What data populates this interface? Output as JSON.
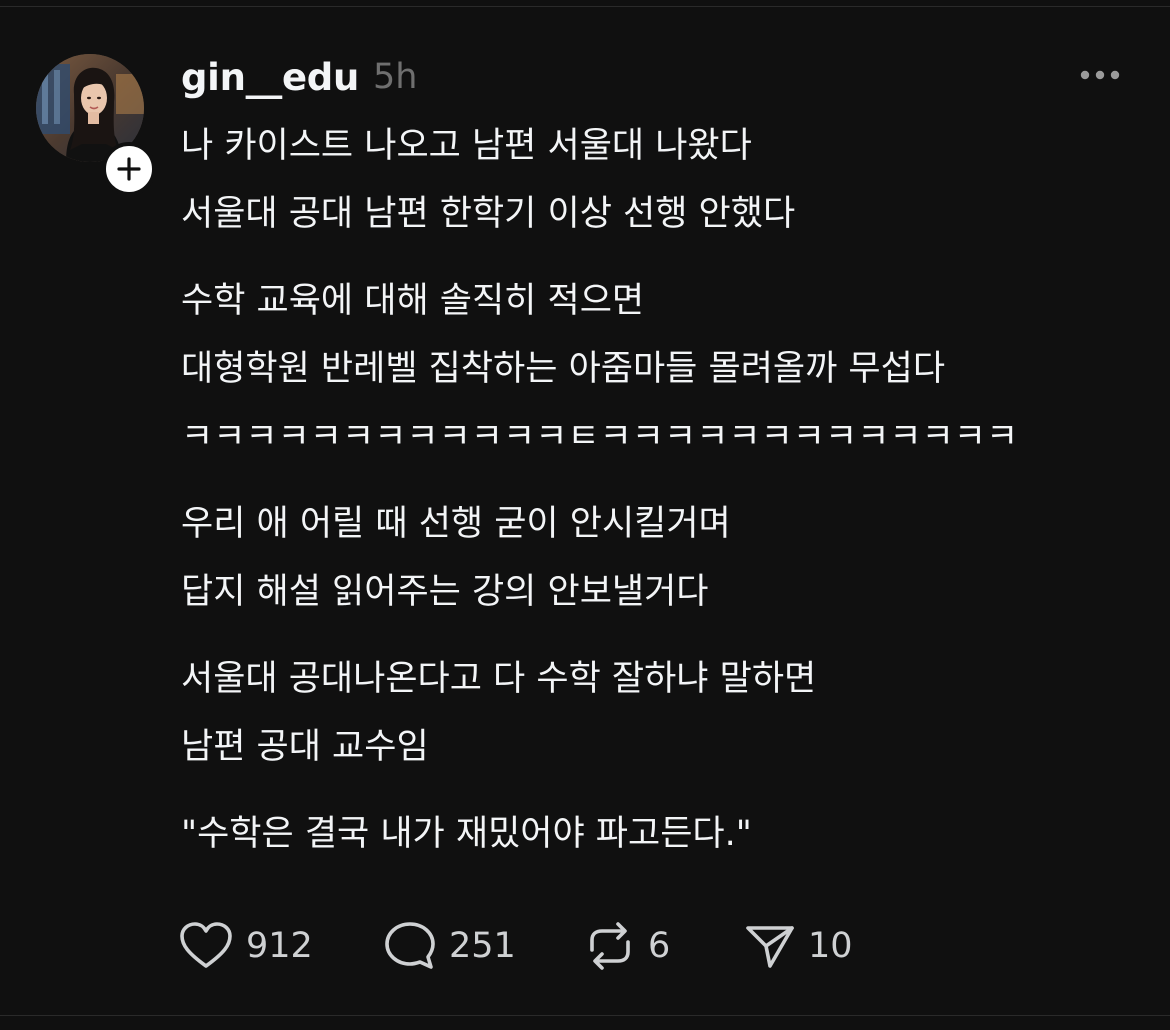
{
  "post": {
    "username": "gin__edu",
    "timestamp": "5h",
    "avatar_icon": "profile-photo",
    "follow_icon": "plus-icon",
    "more_icon": "more-horizontal-icon",
    "body": [
      [
        "나 카이스트 나오고 남편 서울대 나왔다",
        "서울대 공대 남편 한학기 이상 선행 안했다"
      ],
      [
        "수학 교육에 대해 솔직히 적으면",
        "대형학원 반레벨 집착하는 아줌마들 몰려올까 무섭다",
        "ㅋㅋㅋㅋㅋㅋㅋㅋㅋㅋㅋㅋㅌㅋㅋㅋㅋㅋㅋㅋㅋㅋㅋㅋㅋㅋ"
      ],
      [
        "우리 애 어릴 때 선행 굳이 안시킬거며",
        "답지 해설 읽어주는 강의 안보낼거다"
      ],
      [
        "서울대 공대나온다고 다 수학 잘하냐 말하면",
        "남편 공대 교수임"
      ],
      [
        "\"수학은 결국 내가 재밌어야 파고든다.\""
      ]
    ],
    "actions": {
      "likes": "912",
      "replies": "251",
      "reposts": "6",
      "shares": "10"
    }
  },
  "colors": {
    "background": "#101010",
    "text": "#f3f5f7",
    "secondary": "#6f6f6f",
    "count": "#cfd1d3"
  }
}
